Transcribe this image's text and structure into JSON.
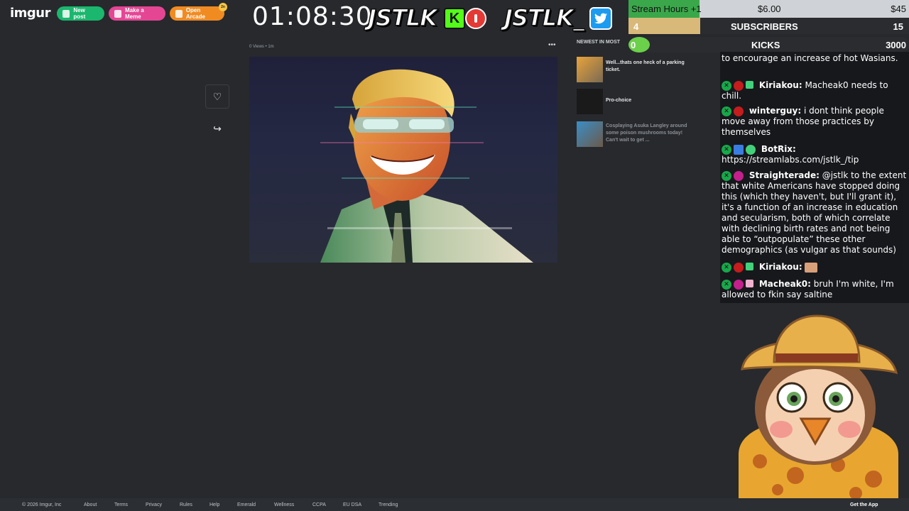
{
  "imgur": {
    "logo": "imgur",
    "new_post": "New post",
    "make_meme": "Make a Meme",
    "open_arcade": "Open Arcade",
    "arcade_badge": "2n"
  },
  "stream": {
    "timer": "01:08:30",
    "brand_left": "JSTLK",
    "brand_left_badge": "K",
    "brand_right": "JSTLK_",
    "goals": {
      "stream_hours_label": "Stream Hours +1",
      "stream_hours_amount": "$6.00",
      "stream_hours_target": "$45",
      "subscribers_current": "4",
      "subscribers_label": "SUBSCRIBERS",
      "subscribers_target": "15",
      "kicks_current": "0",
      "kicks_label": "KICKS",
      "kicks_target": "3000"
    }
  },
  "post": {
    "meta": "0 Views • 1m",
    "menu": "•••",
    "heart_icon": "♡",
    "share_icon": "↪"
  },
  "newest": {
    "title": "NEWEST IN MOST",
    "items": [
      {
        "text": "Well...thats one heck of a parking ticket."
      },
      {
        "text": "Pro-choice"
      },
      {
        "text": "Cosplaying Asuka Langley around some poison mushrooms today! Can't wait to get ..."
      }
    ]
  },
  "chat": {
    "messages": [
      {
        "user": "",
        "text": "to encourage an increase of hot Wasians."
      },
      {
        "user": "Kiriakou:",
        "text": "Macheak0 needs to chill."
      },
      {
        "user": "winterguy:",
        "text": "i dont think people move away from those practices by themselves"
      },
      {
        "user": "BotRix:",
        "text": "https://streamlabs.com/jstlk_/tip"
      },
      {
        "user": "Straighterade:",
        "text": "@jstlk to the extent that white Americans have stopped doing this (which they haven't, but I'll grant it), it's a function of an increase in education and secularism, both of which correlate with declining birth rates and not being able to “outpopulate” these other demographics (as vulgar as that sounds)"
      },
      {
        "user": "Kiriakou:",
        "text": ""
      },
      {
        "user": "Macheak0:",
        "text": "bruh I'm white, I'm allowed to fkin say saltine"
      }
    ]
  },
  "footer": {
    "copyright": "© 2026 Imgur, Inc",
    "links": [
      "About",
      "Terms",
      "Privacy",
      "Rules",
      "Help",
      "Emerald",
      "Wellness",
      "CCPA",
      "EU DSA",
      "Trending"
    ],
    "get_app": "Get the App"
  },
  "colors": {
    "bg": "#27292d",
    "new_post": "#1bb76e",
    "meme": "#e44694",
    "arcade": "#f08b22",
    "kick_green": "#53fc18"
  }
}
